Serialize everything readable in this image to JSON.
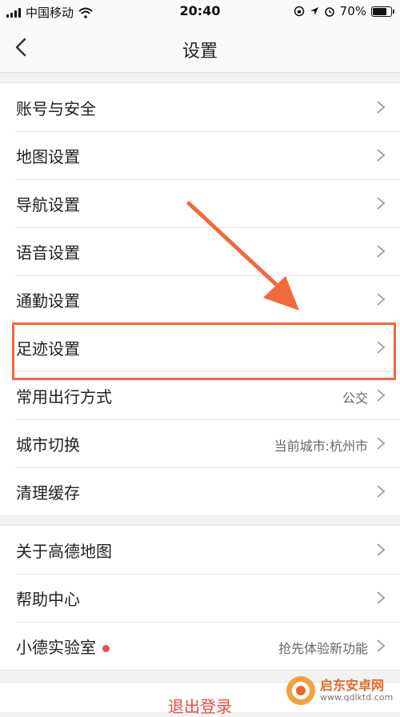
{
  "status_bar": {
    "carrier": "中国移动",
    "time": "20:40",
    "battery_percent": "70%",
    "battery_level": 0.7
  },
  "nav": {
    "title": "设置"
  },
  "groups": {
    "main": [
      {
        "label": "账号与安全",
        "value": ""
      },
      {
        "label": "地图设置",
        "value": ""
      },
      {
        "label": "导航设置",
        "value": ""
      },
      {
        "label": "语音设置",
        "value": ""
      },
      {
        "label": "通勤设置",
        "value": ""
      },
      {
        "label": "足迹设置",
        "value": ""
      },
      {
        "label": "常用出行方式",
        "value": "公交"
      },
      {
        "label": "城市切换",
        "value": "当前城市:杭州市"
      },
      {
        "label": "清理缓存",
        "value": ""
      }
    ],
    "about": [
      {
        "label": "关于高德地图",
        "value": ""
      },
      {
        "label": "帮助中心",
        "value": ""
      },
      {
        "label": "小德实验室",
        "value": "抢先体验新功能",
        "badge": true
      }
    ]
  },
  "logout_label": "退出登录",
  "watermark": {
    "name": "启东安卓网",
    "url": "www.qdlktd.com"
  },
  "colors": {
    "accent": "#f06a3d",
    "logout": "#e54d42",
    "badge": "#e5514a"
  }
}
